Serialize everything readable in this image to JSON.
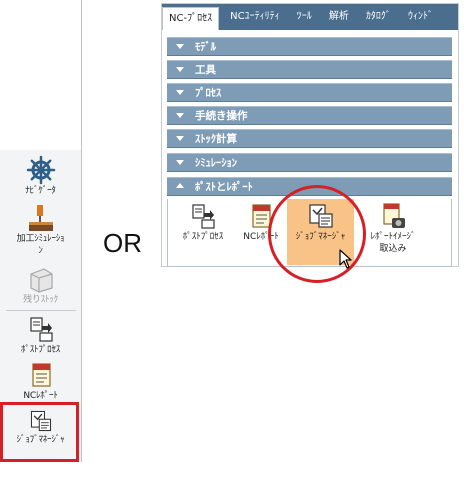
{
  "left_toolbar": {
    "items": [
      {
        "label": "ﾅﾋﾞｹﾞｰﾀ",
        "icon": "ship-wheel-icon"
      },
      {
        "label_line1": "加工ｼﾐｭﾚｰｼｮ",
        "label_line2": "ﾝ",
        "icon": "machining-simulation-icon"
      },
      {
        "label": "残りｽﾄｯｸ",
        "icon": "remaining-stock-icon",
        "disabled": true
      },
      {
        "label": "ﾎﾟｽﾄﾌﾟﾛｾｽ",
        "icon": "post-process-icon"
      },
      {
        "label": "NCﾚﾎﾟｰﾄ",
        "icon": "nc-report-icon"
      },
      {
        "label": "ｼﾞｮﾌﾞﾏﾈｰｼﾞｬ",
        "icon": "job-manager-icon",
        "highlighted": true
      }
    ]
  },
  "or_label": "OR",
  "ribbon": {
    "tabs": [
      "NC-ﾌﾟﾛｾｽ",
      "NCﾕｰﾃｨﾘﾃｨ",
      "ﾂｰﾙ",
      "解析",
      "ｶﾀﾛｸﾞ",
      "ｳｨﾝﾄﾞ"
    ],
    "active_tab": "NC-ﾌﾟﾛｾｽ",
    "groups": [
      {
        "title": "ﾓﾃﾞﾙ",
        "expanded": false
      },
      {
        "title": "工具",
        "expanded": false
      },
      {
        "title": "ﾌﾟﾛｾｽ",
        "expanded": false
      },
      {
        "title": "手続き操作",
        "expanded": false
      },
      {
        "title": "ｽﾄｯｸ計算",
        "expanded": false
      },
      {
        "title": "ｼﾐｭﾚｰｼｮﾝ",
        "expanded": false
      },
      {
        "title": "ﾎﾟｽﾄとﾚﾎﾟｰﾄ",
        "expanded": true
      }
    ],
    "buttons": [
      {
        "label": "ﾎﾟｽﾄﾌﾟﾛｾｽ",
        "icon": "post-process-icon"
      },
      {
        "label": "NCﾚﾎﾟｰﾄ",
        "icon": "nc-report-icon"
      },
      {
        "label": "ｼﾞｮﾌﾞﾏﾈｰｼﾞｬ",
        "icon": "job-manager-icon",
        "selected": true
      },
      {
        "label_line1": "ﾚﾎﾟｰﾄｲﾒｰｼﾞ",
        "label_line2": "取込み",
        "icon": "report-image-import-icon"
      }
    ]
  },
  "colors": {
    "highlight_red": "#d61f26",
    "ribbon_tab_bar": "#4b6e8f",
    "group_header": "#7f9cb6",
    "selected_button": "#f9c387"
  }
}
